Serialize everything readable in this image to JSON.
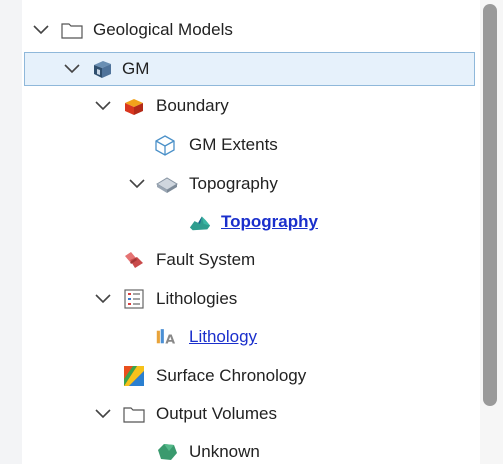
{
  "tree": {
    "items": [
      {
        "label": "Geological Models",
        "icon": "folder-icon"
      },
      {
        "label": "GM",
        "icon": "geological-model-icon"
      },
      {
        "label": "Boundary",
        "icon": "boundary-icon"
      },
      {
        "label": "GM Extents",
        "icon": "extents-box-icon"
      },
      {
        "label": "Topography",
        "icon": "topography-surface-icon"
      },
      {
        "label": "Topography",
        "icon": "topography-mesh-icon"
      },
      {
        "label": "Fault System",
        "icon": "fault-system-icon"
      },
      {
        "label": "Lithologies",
        "icon": "lithologies-list-icon"
      },
      {
        "label": "Lithology",
        "icon": "lithology-icon"
      },
      {
        "label": "Surface Chronology",
        "icon": "surface-chronology-icon"
      },
      {
        "label": "Output Volumes",
        "icon": "folder-icon"
      },
      {
        "label": "Unknown",
        "icon": "volume-icon"
      }
    ]
  },
  "colors": {
    "selected_bg": "#e6f1fb",
    "selected_border": "#8fb8da",
    "link": "#1a2fcc",
    "scrollbar_thumb": "#9a9a9a"
  }
}
